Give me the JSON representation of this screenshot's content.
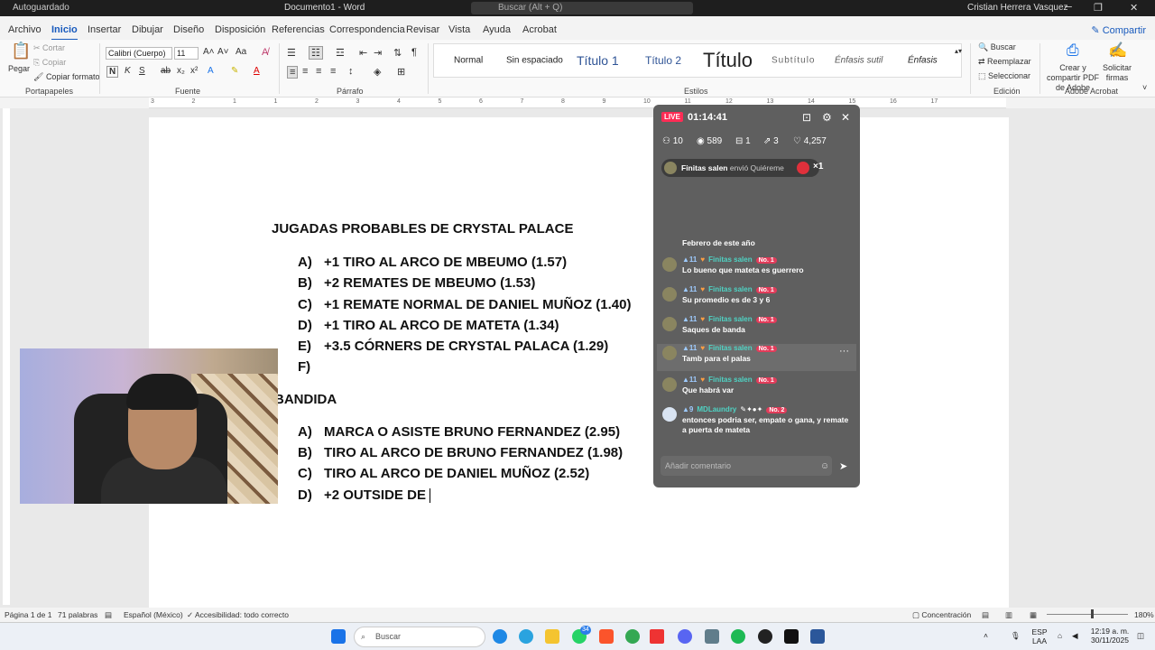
{
  "titlebar": {
    "autosave": "Autoguardado",
    "document": "Documento1 - Word",
    "search_placeholder": "Buscar (Alt + Q)",
    "user": "Cristian Herrera Vasquez"
  },
  "menu": {
    "tabs": [
      "Archivo",
      "Inicio",
      "Insertar",
      "Dibujar",
      "Diseño",
      "Disposición",
      "Referencias",
      "Correspondencia",
      "Revisar",
      "Vista",
      "Ayuda",
      "Acrobat"
    ],
    "share": "Compartir"
  },
  "ribbon": {
    "clipboard": {
      "paste": "Pegar",
      "cut": "Cortar",
      "copy": "Copiar",
      "format_painter": "Copiar formato",
      "label": "Portapapeles"
    },
    "font": {
      "name": "Calibri (Cuerpo)",
      "size": "11",
      "label": "Fuente"
    },
    "paragraph": {
      "label": "Párrafo"
    },
    "styles": {
      "items": [
        "Normal",
        "Sin espaciado",
        "Título 1",
        "Título 2",
        "Título",
        "Subtítulo",
        "Énfasis sutil",
        "Énfasis"
      ],
      "label": "Estilos"
    },
    "editing": {
      "find": "Buscar",
      "replace": "Reemplazar",
      "select": "Seleccionar",
      "label": "Edición"
    },
    "acrobat": {
      "create": "Crear y compartir PDF de Adobe",
      "request": "Solicitar firmas",
      "label": "Adobe Acrobat"
    }
  },
  "ruler_numbers": [
    "3",
    "2",
    "1",
    "1",
    "2",
    "3",
    "4",
    "5",
    "6",
    "7",
    "8",
    "9",
    "10",
    "11",
    "12",
    "13",
    "14",
    "15",
    "16",
    "17"
  ],
  "document": {
    "heading1": "JUGADAS PROBABLES DE CRYSTAL PALACE",
    "list1": [
      {
        "letter": "A)",
        "text": "+1 TIRO AL ARCO DE MBEUMO (1.57)"
      },
      {
        "letter": "B)",
        "text": "+2 REMATES DE MBEUMO (1.53)"
      },
      {
        "letter": "C)",
        "text": "+1 REMATE NORMAL DE DANIEL MUÑOZ (1.40)"
      },
      {
        "letter": "D)",
        "text": "+1 TIRO AL ARCO DE MATETA (1.34)"
      },
      {
        "letter": "E)",
        "text": "+3.5 CÓRNERS DE CRYSTAL PALACA (1.29)"
      },
      {
        "letter": "F)",
        "text": ""
      }
    ],
    "heading2": "BANDIDA",
    "list2": [
      {
        "letter": "A)",
        "text": "MARCA O ASISTE BRUNO FERNANDEZ (2.95)"
      },
      {
        "letter": "B)",
        "text": "TIRO AL ARCO DE BRUNO FERNANDEZ (1.98)"
      },
      {
        "letter": "C)",
        "text": "TIRO AL ARCO DE DANIEL MUÑOZ (2.52)"
      },
      {
        "letter": "D)",
        "text": "+2 OUTSIDE DE"
      }
    ]
  },
  "live": {
    "badge": "LIVE",
    "timer": "01:14:41",
    "stats": {
      "members": "10",
      "viewers": "589",
      "gifts": "1",
      "shares": "3",
      "likes": "4,257"
    },
    "gift_event": {
      "user": "Finitas salen",
      "action": "envió Quiéreme",
      "count": "×1"
    },
    "messages": [
      {
        "user": "",
        "level": "",
        "rank": "",
        "text": "Febrero de este año"
      },
      {
        "user": "Finitas salen",
        "level": "11",
        "rank": "No. 1",
        "text": "Lo bueno que mateta es guerrero"
      },
      {
        "user": "Finitas salen",
        "level": "11",
        "rank": "No. 1",
        "text": "Su promedio es de 3 y 6"
      },
      {
        "user": "Finitas salen",
        "level": "11",
        "rank": "No. 1",
        "text": "Saques de banda"
      },
      {
        "user": "Finitas salen",
        "level": "11",
        "rank": "No. 1",
        "text": "Tamb para el palas"
      },
      {
        "user": "Finitas salen",
        "level": "11",
        "rank": "No. 1",
        "text": "Que habrá var"
      },
      {
        "user": "MDLaundry",
        "level": "9",
        "rank": "No. 2",
        "text": "entonces podria ser, empate o gana, y remate a puerta de mateta"
      }
    ],
    "comment_placeholder": "Añadir comentario"
  },
  "status": {
    "page": "Página 1 de 1",
    "words": "71 palabras",
    "language": "Español (México)",
    "accessibility": "Accesibilidad: todo correcto",
    "focus": "Concentración",
    "zoom": "180%"
  },
  "taskbar": {
    "search_placeholder": "Buscar",
    "badge": "34",
    "lang1": "ESP",
    "lang2": "LAA",
    "time": "12:19 a. m.",
    "date": "30/11/2025"
  }
}
